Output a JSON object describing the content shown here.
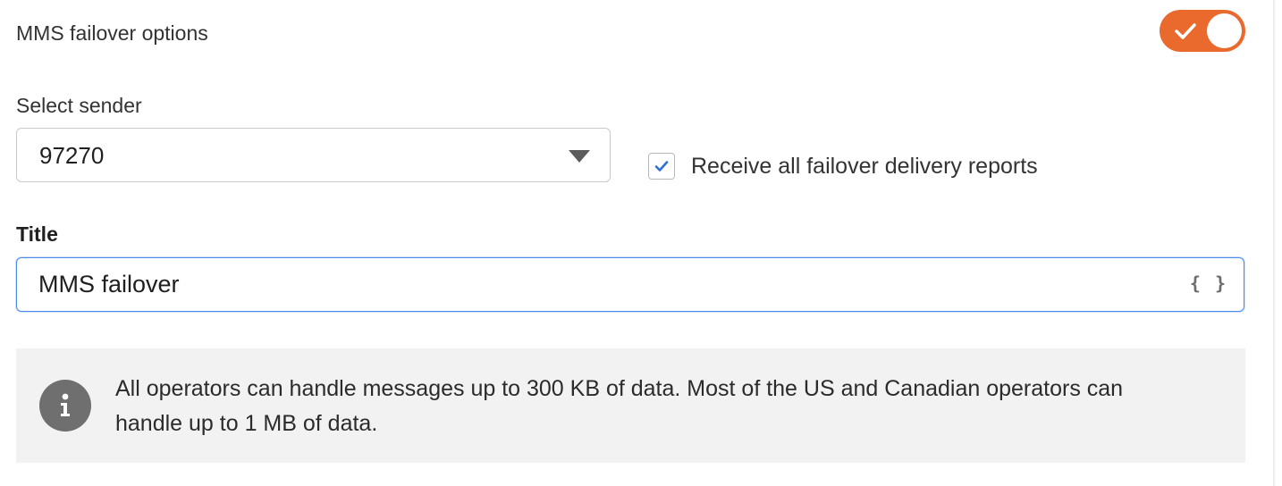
{
  "failover": {
    "title": "MMS failover options",
    "toggle_enabled": true
  },
  "sender": {
    "label": "Select sender",
    "selected_value": "97270"
  },
  "delivery_reports": {
    "label": "Receive all failover delivery reports",
    "checked": true
  },
  "title_field": {
    "label": "Title",
    "value": "MMS failover",
    "variables_icon": "{ }"
  },
  "info": {
    "icon": "info-icon",
    "text": "All operators can handle messages up to 300 KB of data. Most of the US and Canadian operators can handle up to 1 MB of data."
  },
  "colors": {
    "accent": "#ea6a2e",
    "focus_border": "#4a8bf0",
    "check": "#2f6fd6",
    "info_bg": "#f2f2f2"
  }
}
